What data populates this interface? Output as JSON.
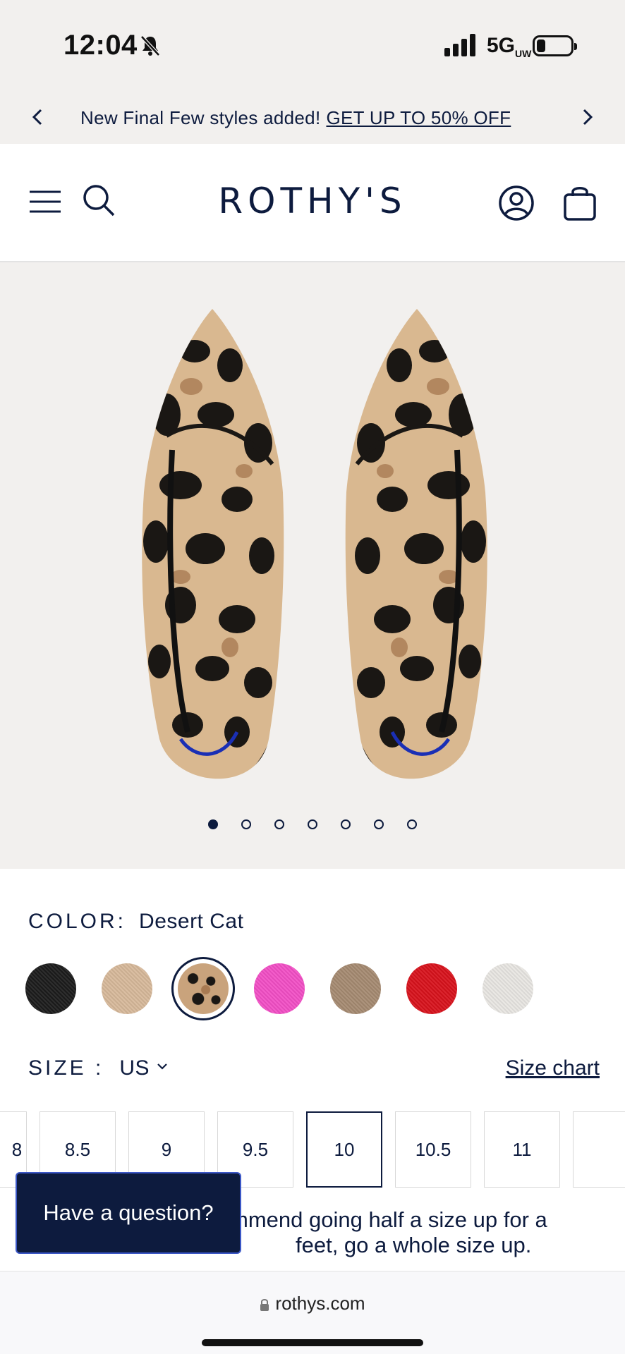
{
  "status": {
    "time": "12:04",
    "network_main": "5G",
    "network_sup": "UW"
  },
  "promo": {
    "text": "New Final Few styles added!",
    "link": "GET UP TO 50% OFF"
  },
  "header": {
    "logo": "ROTHY'S"
  },
  "gallery": {
    "image_count": 7,
    "active_index": 0
  },
  "product": {
    "color_label": "COLOR:",
    "color_value": "Desert Cat",
    "swatches": [
      {
        "name": "black",
        "color": "#1c1c1c"
      },
      {
        "name": "tan",
        "color": "#d7b99a"
      },
      {
        "name": "desert-cat",
        "color": "#c9a37c",
        "selected": true
      },
      {
        "name": "pink",
        "color": "#f24fc6"
      },
      {
        "name": "taupe",
        "color": "#a58a71"
      },
      {
        "name": "red",
        "color": "#d8121c"
      },
      {
        "name": "white",
        "color": "#e8e6e2"
      }
    ],
    "size_label": "SIZE :",
    "size_unit": "US",
    "size_chart": "Size chart",
    "sizes": [
      "8",
      "8.5",
      "9",
      "9.5",
      "10",
      "10.5",
      "11"
    ],
    "selected_size": "10",
    "fit_line1": "mmend going half a size up for a",
    "fit_line2": "feet, go a whole size up."
  },
  "chat": {
    "label": "Have a question?"
  },
  "browser": {
    "url": "rothys.com"
  },
  "colors": {
    "brand_navy": "#0d1b3e",
    "page_bg": "#f2f0ee",
    "chat_border": "#3b57c6"
  }
}
